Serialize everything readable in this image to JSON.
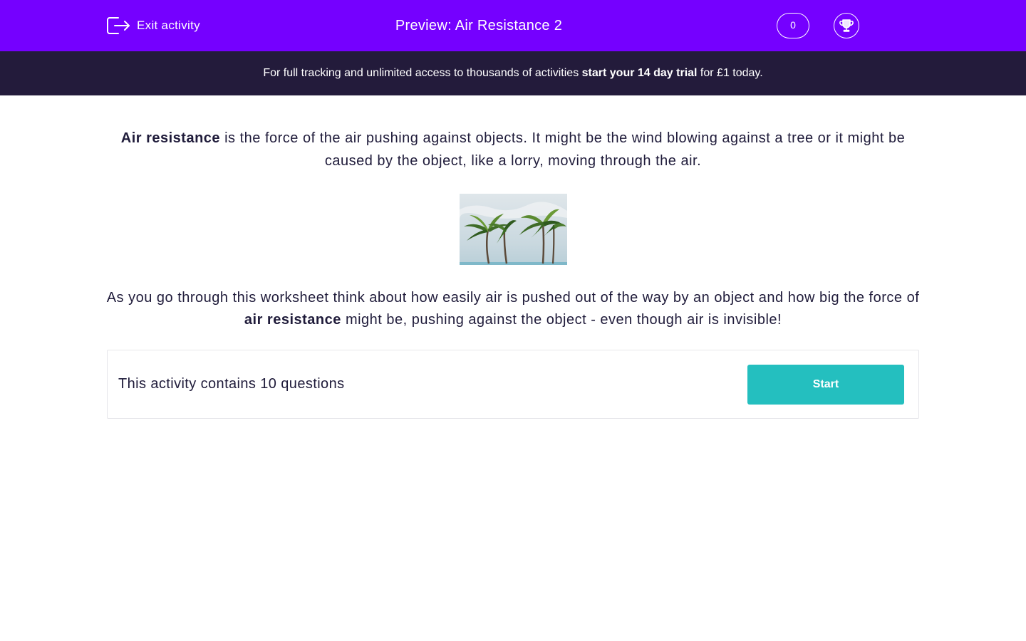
{
  "header": {
    "exit_label": "Exit activity",
    "title": "Preview: Air Resistance 2",
    "score": "0",
    "exit_icon": "exit-icon",
    "trophy_icon": "trophy-icon"
  },
  "promo": {
    "prefix": "For full tracking and unlimited access to thousands of activities ",
    "cta": "start your 14 day trial",
    "suffix": " for £1 today."
  },
  "intro": {
    "bold": "Air resistance",
    "rest": " is the force of the air pushing against objects. It might be the wind blowing against a tree or it might be caused by the object, like a lorry, moving through the air."
  },
  "illustration": {
    "subject": "palm trees bending in strong wind"
  },
  "outro": {
    "before": "As you go through this worksheet think about how easily air is pushed out of the way by an object and how big the force of ",
    "bold": "air resistance",
    "after": " might be, pushing against the object - even though air is invisible!"
  },
  "activity": {
    "summary": "This activity contains 10 questions",
    "start_label": "Start"
  },
  "colors": {
    "header_bg": "#7500ff",
    "promo_bg": "#231b3b",
    "start_button": "#24bfbf",
    "text": "#1f1b3a"
  }
}
